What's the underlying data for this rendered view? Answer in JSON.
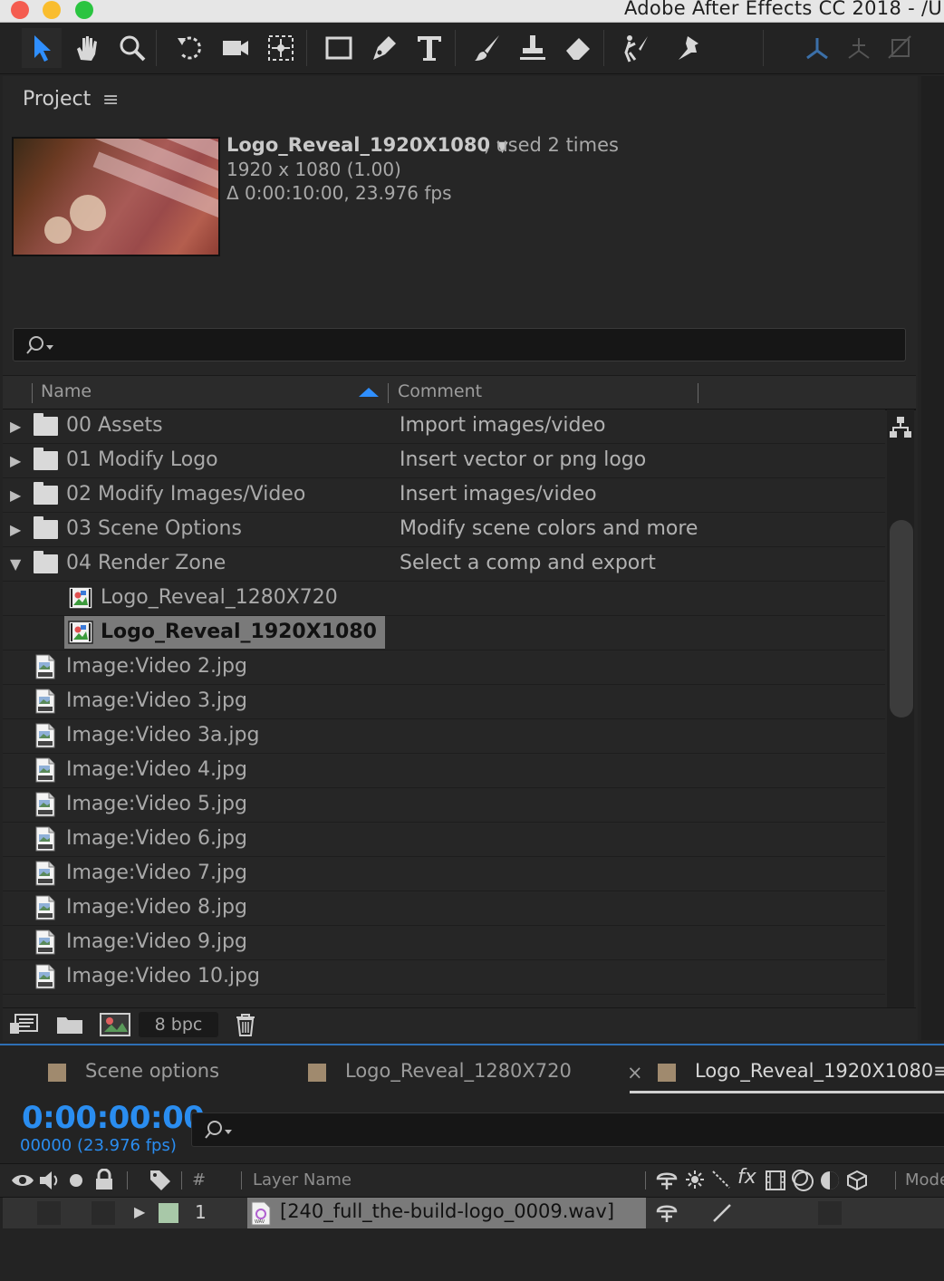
{
  "window": {
    "title": "Adobe After Effects CC 2018 - /U",
    "traffic_lights": {
      "close": "#f45c50",
      "minimize": "#f9bd2e",
      "zoom": "#2ac440"
    }
  },
  "toolbar": {
    "tools": [
      "selection-tool",
      "hand-tool",
      "zoom-tool",
      "rotate-tool",
      "camera-tool",
      "pan-behind-tool",
      "rectangle-tool",
      "pen-tool",
      "type-tool",
      "brush-tool",
      "clone-stamp-tool",
      "eraser-tool",
      "roto-brush-tool",
      "puppet-pin-tool"
    ]
  },
  "project": {
    "tab_label": "Project",
    "selected": {
      "name": "Logo_Reveal_1920X1080",
      "used": ", used 2 times",
      "resolution": "1920 x 1080 (1.00)",
      "duration": "Δ 0:00:10:00, 23.976 fps"
    },
    "search": {
      "placeholder": ""
    },
    "columns": {
      "name": "Name",
      "comment": "Comment"
    },
    "items": [
      {
        "type": "folder",
        "expanded": false,
        "name": "00 Assets",
        "comment": "Import images/video"
      },
      {
        "type": "folder",
        "expanded": false,
        "name": "01 Modify Logo",
        "comment": "Insert vector or png logo"
      },
      {
        "type": "folder",
        "expanded": false,
        "name": "02 Modify Images/Video",
        "comment": "Insert images/video"
      },
      {
        "type": "folder",
        "expanded": false,
        "name": "03 Scene Options",
        "comment": "Modify scene colors and more"
      },
      {
        "type": "folder",
        "expanded": true,
        "name": "04 Render Zone",
        "comment": "Select a comp and export"
      },
      {
        "type": "comp",
        "name": "Logo_Reveal_1280X720",
        "comment": ""
      },
      {
        "type": "comp",
        "name": "Logo_Reveal_1920X1080",
        "comment": "",
        "selected": true
      },
      {
        "type": "jpg",
        "name": "Image:Video 2.jpg",
        "comment": ""
      },
      {
        "type": "jpg",
        "name": "Image:Video 3.jpg",
        "comment": ""
      },
      {
        "type": "jpg",
        "name": "Image:Video 3a.jpg",
        "comment": ""
      },
      {
        "type": "jpg",
        "name": "Image:Video 4.jpg",
        "comment": ""
      },
      {
        "type": "jpg",
        "name": "Image:Video 5.jpg",
        "comment": ""
      },
      {
        "type": "jpg",
        "name": "Image:Video 6.jpg",
        "comment": ""
      },
      {
        "type": "jpg",
        "name": "Image:Video 7.jpg",
        "comment": ""
      },
      {
        "type": "jpg",
        "name": "Image:Video 8.jpg",
        "comment": ""
      },
      {
        "type": "jpg",
        "name": "Image:Video 9.jpg",
        "comment": ""
      },
      {
        "type": "jpg",
        "name": "Image:Video 10.jpg",
        "comment": ""
      }
    ],
    "bit_depth": "8 bpc"
  },
  "timeline": {
    "tabs": [
      {
        "label": "Scene options",
        "active": false
      },
      {
        "label": "Logo_Reveal_1280X720",
        "active": false
      },
      {
        "label": "Logo_Reveal_1920X1080",
        "active": true
      }
    ],
    "close_glyph": "×",
    "timecode": "0:00:00:00",
    "frame_info": "00000 (23.976 fps)",
    "columns": {
      "number": "#",
      "layer_name": "Layer Name",
      "mode": "Mode"
    },
    "layers": [
      {
        "index": "1",
        "name": "[240_full_the-build-logo_0009.wav]",
        "label_color": "#a8c8a8"
      }
    ],
    "accent_color": "#2a8df0"
  }
}
